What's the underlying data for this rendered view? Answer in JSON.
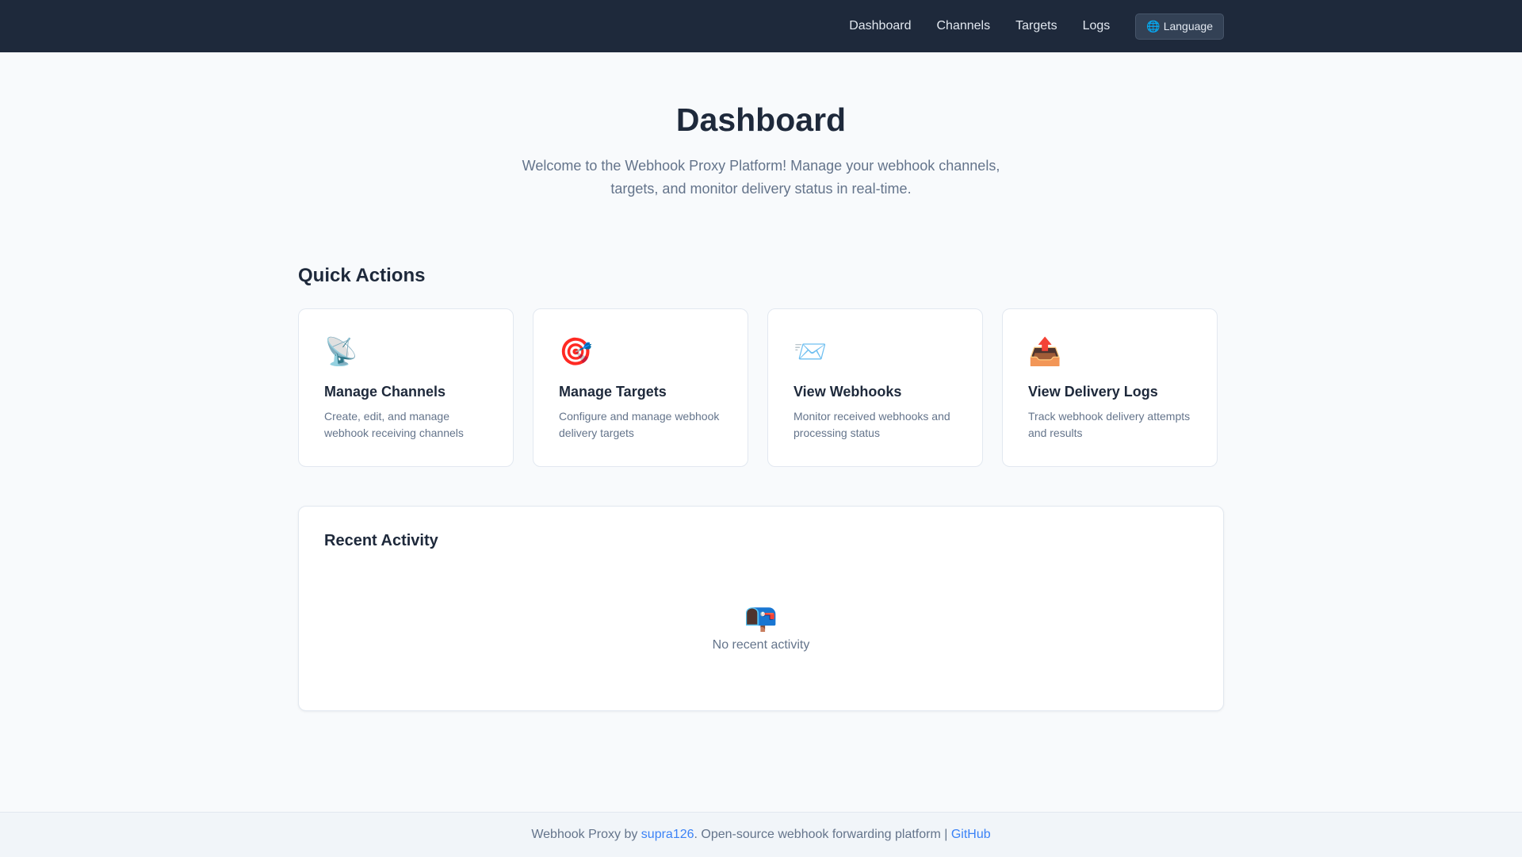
{
  "nav": {
    "items": [
      {
        "label": "Dashboard"
      },
      {
        "label": "Channels"
      },
      {
        "label": "Targets"
      },
      {
        "label": "Logs"
      }
    ],
    "language_label": "Language",
    "language_icon": "globe-icon"
  },
  "hero": {
    "title": "Dashboard",
    "subtitle": "Welcome to the Webhook Proxy Platform! Manage your webhook channels, targets, and monitor delivery status in real-time."
  },
  "quick_actions": {
    "title": "Quick Actions",
    "cards": [
      {
        "icon": "satellite-dish-icon",
        "glyph": "📡",
        "title": "Manage Channels",
        "desc": "Create, edit, and manage webhook receiving channels"
      },
      {
        "icon": "target-icon",
        "glyph": "🎯",
        "title": "Manage Targets",
        "desc": "Configure and manage webhook delivery targets"
      },
      {
        "icon": "incoming-envelope-icon",
        "glyph": "📨",
        "title": "View Webhooks",
        "desc": "Monitor received webhooks and processing status"
      },
      {
        "icon": "outbox-tray-icon",
        "glyph": "📤",
        "title": "View Delivery Logs",
        "desc": "Track webhook delivery attempts and results"
      }
    ]
  },
  "recent_activity": {
    "title": "Recent Activity",
    "empty_icon": "mailbox-icon",
    "empty_glyph": "📭",
    "empty_message": "No recent activity"
  },
  "footer": {
    "prefix": "Webhook Proxy by ",
    "author": "supra126",
    "middle": ". Open-source webhook forwarding platform | ",
    "github": "GitHub"
  },
  "colors": {
    "topbar": "#1e293b",
    "background": "#f8fafc",
    "link": "#3b82f6",
    "muted_text": "#64748b"
  }
}
